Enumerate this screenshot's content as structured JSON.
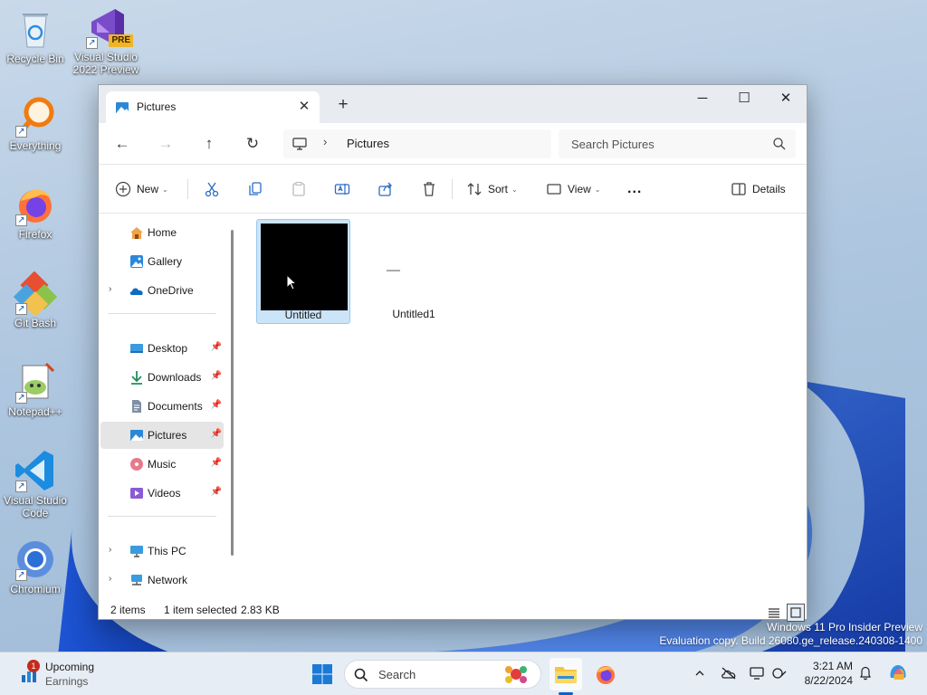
{
  "desktop": {
    "icons": [
      {
        "label": "Recycle Bin"
      },
      {
        "label": "Visual Studio 2022 Preview",
        "badge": "PRE"
      },
      {
        "label": "Everything"
      },
      {
        "label": "Firefox"
      },
      {
        "label": "Git Bash"
      },
      {
        "label": "Notepad++"
      },
      {
        "label": "Visual Studio Code"
      },
      {
        "label": "Chromium"
      }
    ]
  },
  "window": {
    "tab_title": "Pictures",
    "address": {
      "crumb": "Pictures",
      "search_placeholder": "Search Pictures"
    },
    "toolbar": {
      "new_label": "New",
      "sort_label": "Sort",
      "view_label": "View",
      "more_label": "...",
      "details_label": "Details"
    },
    "nav": {
      "items": [
        {
          "label": "Home",
          "icon": "home-icon"
        },
        {
          "label": "Gallery",
          "icon": "gallery-icon"
        },
        {
          "label": "OneDrive",
          "icon": "onedrive-icon",
          "expandable": true
        },
        {
          "label": "Desktop",
          "icon": "desktop-folder-icon",
          "pinned": true
        },
        {
          "label": "Downloads",
          "icon": "downloads-icon",
          "pinned": true
        },
        {
          "label": "Documents",
          "icon": "documents-icon",
          "pinned": true
        },
        {
          "label": "Pictures",
          "icon": "pictures-icon",
          "pinned": true,
          "selected": true
        },
        {
          "label": "Music",
          "icon": "music-icon",
          "pinned": true
        },
        {
          "label": "Videos",
          "icon": "videos-icon",
          "pinned": true
        },
        {
          "label": "This PC",
          "icon": "this-pc-icon",
          "expandable": true
        },
        {
          "label": "Network",
          "icon": "network-icon",
          "expandable": true
        }
      ]
    },
    "files": [
      {
        "name": "Untitled",
        "selected": true,
        "thumbnail": "black"
      },
      {
        "name": "Untitled1",
        "selected": false,
        "thumbnail": "blank"
      }
    ],
    "status": {
      "item_count": "2 items",
      "selection": "1 item selected",
      "size": "2.83 KB"
    }
  },
  "watermark": {
    "line1": "Windows 11 Pro Insider Preview",
    "line2": "Evaluation copy. Build 26080.ge_release.240308-1400"
  },
  "taskbar": {
    "widget": {
      "title": "Upcoming",
      "subtitle": "Earnings",
      "badge": "1"
    },
    "search_label": "Search",
    "clock": {
      "time": "3:21 AM",
      "date": "8/22/2024"
    }
  },
  "colors": {
    "accent": "#0a64c2",
    "selection": "#cce4f7",
    "selection_border": "#99c9ef",
    "badge": "#c42b1c"
  }
}
